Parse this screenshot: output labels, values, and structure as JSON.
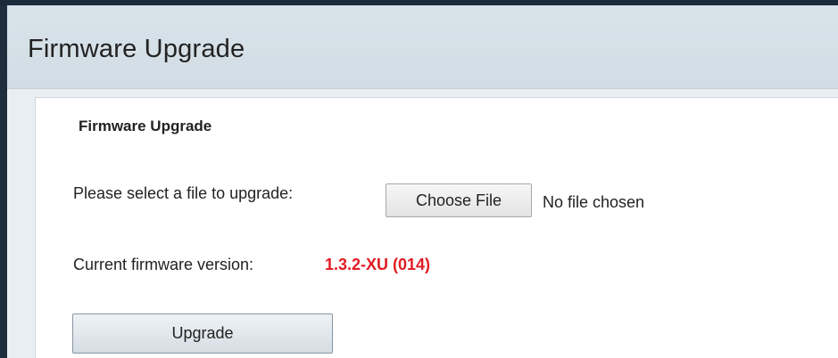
{
  "page": {
    "title": "Firmware Upgrade"
  },
  "section": {
    "title": "Firmware Upgrade"
  },
  "file_select": {
    "label": "Please select a file to upgrade:",
    "button_label": "Choose File",
    "status": "No file chosen"
  },
  "firmware": {
    "label": "Current firmware version:",
    "version": "1.3.2-XU (014)"
  },
  "actions": {
    "upgrade_label": "Upgrade"
  },
  "colors": {
    "header_bg": "#d5dfe7",
    "content_bg": "#e9eef2",
    "frame_dark": "#1f2e3c",
    "version_text": "#e21b23"
  }
}
